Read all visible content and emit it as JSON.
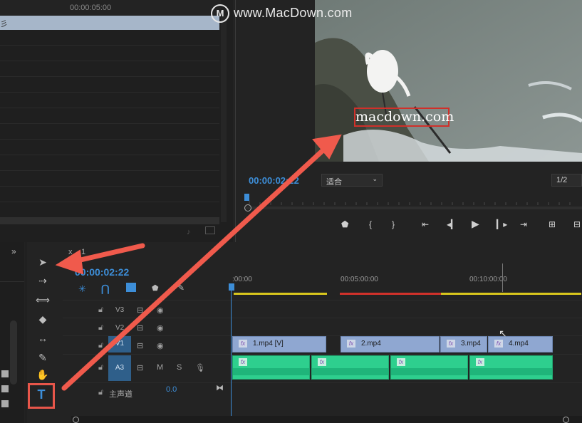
{
  "watermark": {
    "text": "www.MacDown.com"
  },
  "source": {
    "timecode": "00:00:05:00",
    "bar_label": "彡"
  },
  "program": {
    "timecode": "00:00:02:22",
    "fit": "适合",
    "resolution": "1/2",
    "overlay_text": "macdown.com"
  },
  "timeline": {
    "timecode": "00:00:02:22",
    "ruler": [
      ":00:00",
      "00:05:00:00",
      "00:10:00:00"
    ],
    "tracks": {
      "v3": "V3",
      "v2": "V2",
      "v1": "V1",
      "a3": "A3",
      "m": "M",
      "s": "S"
    },
    "clips": [
      {
        "name": "1.mp4 [V]"
      },
      {
        "name": "2.mp4"
      },
      {
        "name": "3.mp4"
      },
      {
        "name": "4.mp4"
      }
    ],
    "master": {
      "label": "主声道",
      "value": "0.0"
    }
  },
  "tab": {
    "fx": "x",
    "num": "1"
  },
  "icons": {
    "selection": "selection-arrow-icon",
    "type": "type-tool-icon"
  },
  "colors": {
    "accent": "#3d8ed8",
    "arrow": "#f05a4c",
    "video_clip": "#8fa7d1",
    "audio_clip": "#2ecf8e"
  }
}
